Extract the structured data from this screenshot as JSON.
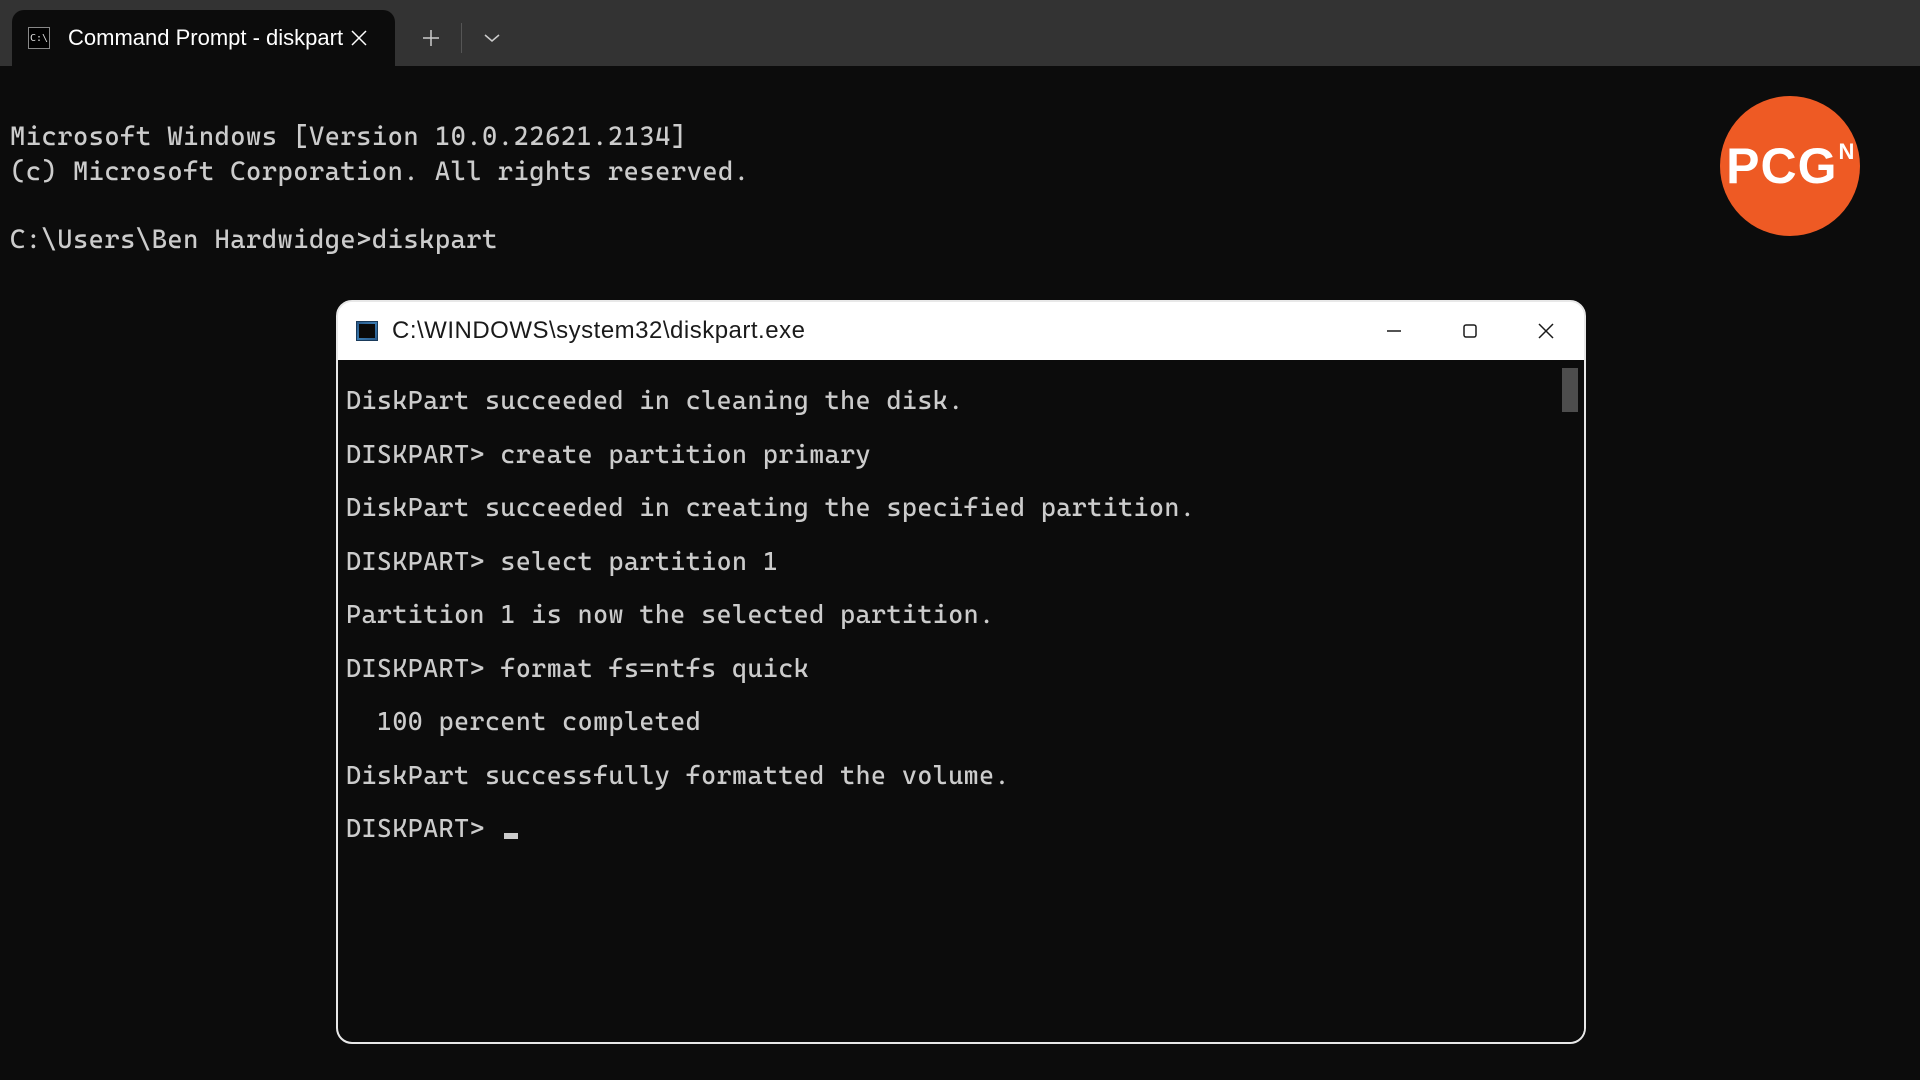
{
  "tab": {
    "title": "Command Prompt - diskpart",
    "icon_name": "cmd-icon"
  },
  "terminal": {
    "line1": "Microsoft Windows [Version 10.0.22621.2134]",
    "line2": "(c) Microsoft Corporation. All rights reserved.",
    "prompt": "C:\\Users\\Ben Hardwidge>",
    "command": "diskpart"
  },
  "subwindow": {
    "title": "C:\\WINDOWS\\system32\\diskpart.exe",
    "lines": [
      "DiskPart succeeded in cleaning the disk.",
      "",
      "DISKPART> create partition primary",
      "",
      "DiskPart succeeded in creating the specified partition.",
      "",
      "DISKPART> select partition 1",
      "",
      "Partition 1 is now the selected partition.",
      "",
      "DISKPART> format fs=ntfs quick",
      "",
      "  100 percent completed",
      "",
      "DiskPart successfully formatted the volume.",
      "",
      "DISKPART> "
    ]
  },
  "logo": {
    "main": "PCG",
    "sup": "N"
  }
}
